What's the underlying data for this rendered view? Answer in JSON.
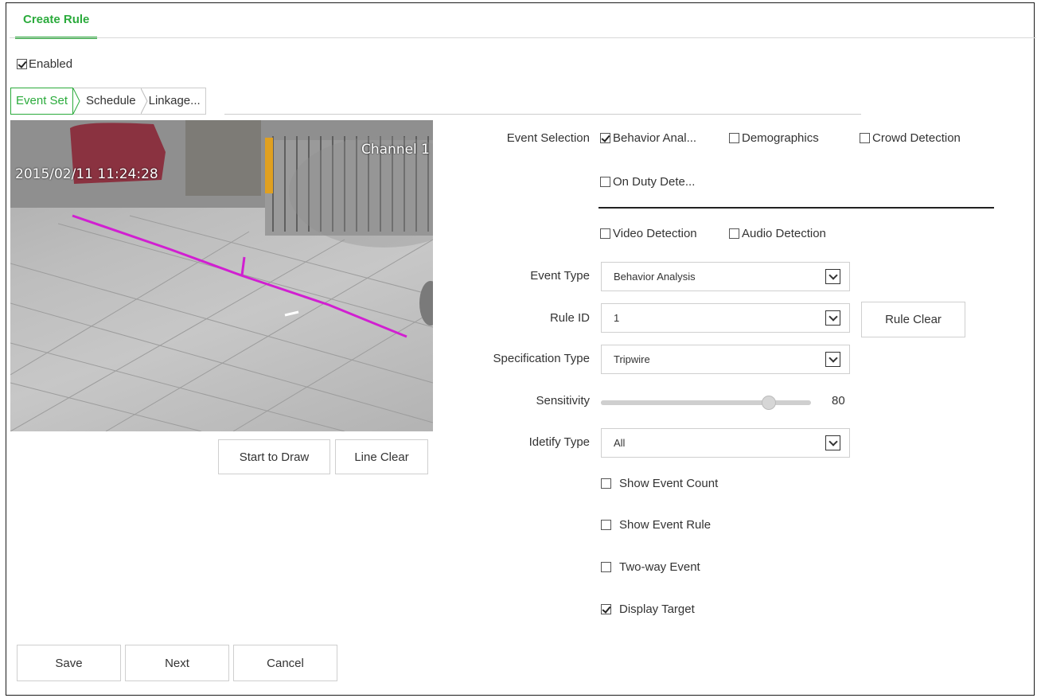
{
  "header": {
    "title": "Create Rule"
  },
  "enabled": {
    "label": "Enabled",
    "checked": true
  },
  "steps": [
    "Event Set",
    "Schedule",
    "Linkage..."
  ],
  "video": {
    "timestamp": "2015/02/11 11:24:28",
    "channel": "Channel 1"
  },
  "draw_buttons": {
    "start": "Start to Draw",
    "clear": "Line Clear"
  },
  "event_selection": {
    "label": "Event Selection",
    "options": [
      {
        "label": "Behavior Anal...",
        "checked": true
      },
      {
        "label": "Demographics",
        "checked": false
      },
      {
        "label": "Crowd Detection",
        "checked": false
      },
      {
        "label": "On Duty Dete...",
        "checked": false
      }
    ],
    "extra": [
      {
        "label": "Video Detection",
        "checked": false
      },
      {
        "label": "Audio Detection",
        "checked": false
      }
    ]
  },
  "event_type": {
    "label": "Event Type",
    "value": "Behavior Analysis"
  },
  "rule_id": {
    "label": "Rule ID",
    "value": "1",
    "clear_label": "Rule Clear"
  },
  "spec_type": {
    "label": "Specification Type",
    "value": "Tripwire"
  },
  "sensitivity": {
    "label": "Sensitivity",
    "value": "80",
    "fraction": 0.8
  },
  "identify_type": {
    "label": "Idetify Type",
    "value": "All"
  },
  "flags": [
    {
      "label": "Show Event Count",
      "checked": false
    },
    {
      "label": "Show Event Rule",
      "checked": false
    },
    {
      "label": "Two-way Event",
      "checked": false
    },
    {
      "label": "Display Target",
      "checked": true
    }
  ],
  "footer": {
    "save": "Save",
    "next": "Next",
    "cancel": "Cancel"
  },
  "colors": {
    "accent": "#2bab3c",
    "tripwire": "#d11fd1"
  }
}
